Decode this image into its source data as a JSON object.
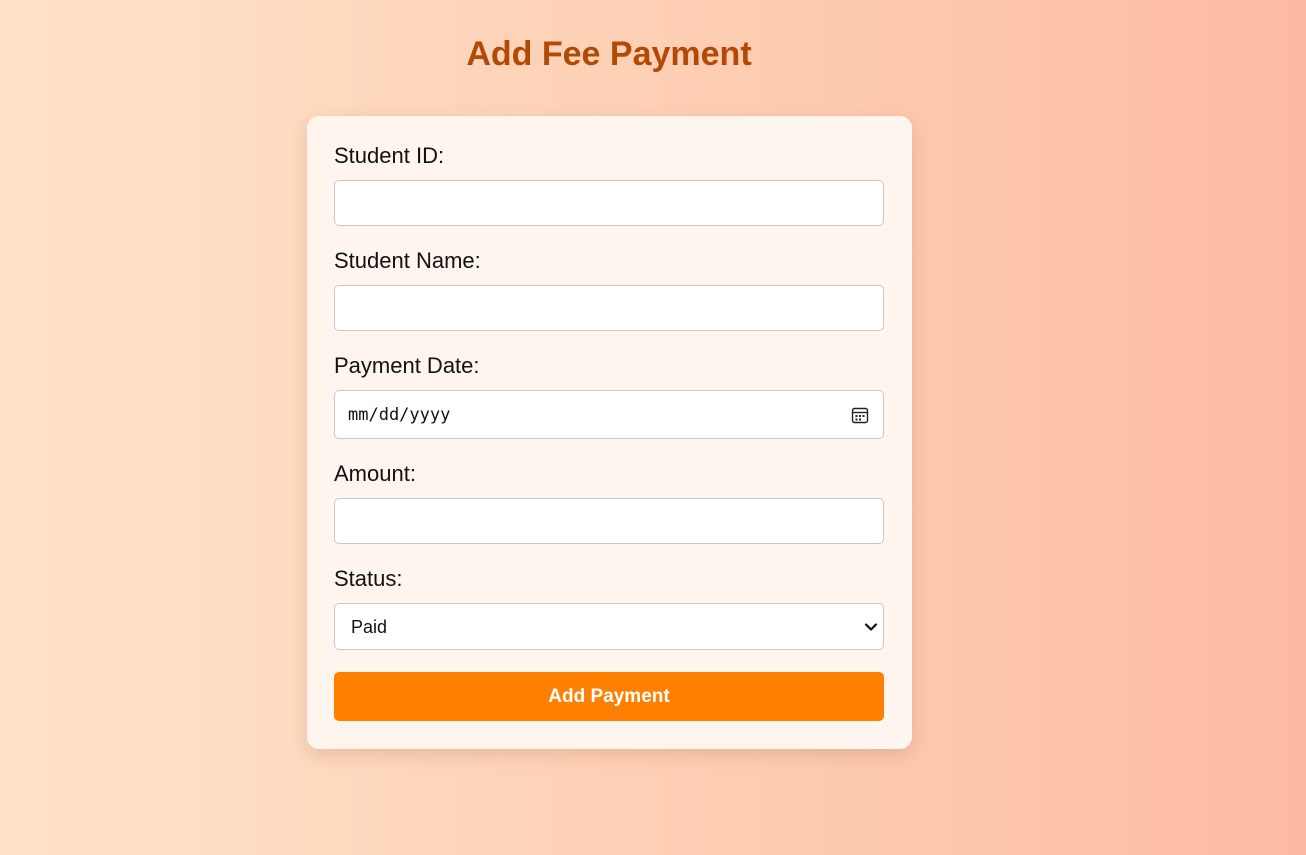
{
  "page": {
    "title": "Add Fee Payment"
  },
  "form": {
    "fields": [
      {
        "label": "Student ID:",
        "value": ""
      },
      {
        "label": "Student Name:",
        "value": ""
      },
      {
        "label": "Payment Date:",
        "placeholder": "mm/dd/yyyy"
      },
      {
        "label": "Amount:",
        "value": ""
      },
      {
        "label": "Status:",
        "selected": "Paid"
      }
    ],
    "submit_label": "Add Payment"
  },
  "icons": {
    "date_picker": "calendar-icon",
    "select_arrow": "chevron-down-icon"
  },
  "colors": {
    "title": "#b24a06",
    "button": "#ff8000",
    "card": "#fff5ef"
  }
}
